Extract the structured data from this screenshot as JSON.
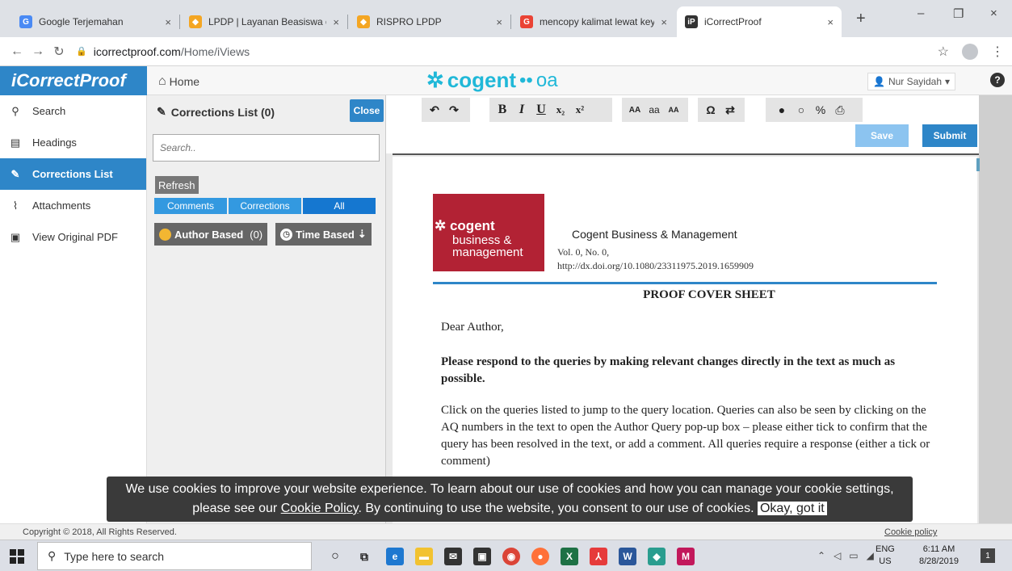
{
  "browser": {
    "tabs": [
      {
        "title": "Google Terjemahan",
        "icon": "google-translate-icon",
        "color": "#4a8af4"
      },
      {
        "title": "LPDP | Layanan Beasiswa da",
        "icon": "lpdp-icon",
        "color": "#f4a623"
      },
      {
        "title": "RISPRO LPDP",
        "icon": "lpdp-icon",
        "color": "#f4a623"
      },
      {
        "title": "mencopy kalimat lewat key",
        "icon": "google-icon",
        "color": "#ea4335"
      },
      {
        "title": "iCorrectProof",
        "icon": "icorrectproof-icon",
        "color": "#333333"
      }
    ],
    "tab_close": "×",
    "new_tab": "+",
    "window": {
      "minimize": "–",
      "restore": "❐",
      "close": "×"
    },
    "url_host": "icorrectproof.com",
    "url_path": "/Home/iViews"
  },
  "app": {
    "logo": "iCorrectProof",
    "home": "Home",
    "brand": "cogent",
    "brand_suffix": "oa",
    "user": "Nur Sayidah",
    "help": "?"
  },
  "nav": {
    "items": [
      {
        "label": "Search",
        "icon": "search-icon",
        "glyph": "⚲",
        "active": false
      },
      {
        "label": "Headings",
        "icon": "document-icon",
        "glyph": "🗎",
        "active": false
      },
      {
        "label": "Corrections List",
        "icon": "edit-icon",
        "glyph": "✎",
        "active": true
      },
      {
        "label": "Attachments",
        "icon": "paperclip-icon",
        "glyph": "✎",
        "active": false
      },
      {
        "label": "View Original PDF",
        "icon": "pdf-icon",
        "glyph": "🗎",
        "active": false
      }
    ]
  },
  "panel": {
    "title": "Corrections List (0)",
    "close": "Close",
    "search_placeholder": "Search..",
    "refresh": "Refresh",
    "filters": [
      "Comments",
      "Corrections",
      "All"
    ],
    "author_based": "Author Based",
    "author_count": "(0)",
    "time_based": "Time Based"
  },
  "toolbar": {
    "undo": "↶",
    "redo": "↷",
    "bold": "B",
    "italic": "I",
    "underline": "U",
    "subscript": "x₂",
    "superscript": "x²",
    "upper": "AA",
    "lower": "aa",
    "smallcaps": "AA",
    "special": "Ω",
    "swap": "⇄",
    "comment": "●",
    "bubble": "○",
    "link": "%",
    "print": "⎙",
    "save": "Save",
    "submit": "Submit"
  },
  "document": {
    "journal_logo_line1": "cogent",
    "journal_logo_line2": "business &",
    "journal_logo_line3": "management",
    "journal_title": "Cogent Business & Management",
    "volume": "Vol. 0, No. 0,",
    "doi": "http://dx.doi.org/10.1080/23311975.2019.1659909",
    "heading": "PROOF COVER SHEET",
    "greeting": "Dear Author,",
    "bold_paragraph": "Please respond to the queries by making relevant changes directly in the text as much as possible.",
    "paragraph": "Click on the queries listed to jump to the query location. Queries can also be seen by clicking on the AQ numbers in the text to open the Author Query pop-up box – please either tick to confirm that the query has been resolved in the text, or add a comment. All queries require a response (either a tick or comment)"
  },
  "cookie": {
    "text1": "We use cookies to improve your website experience. To learn about our use of cookies and how you can manage your cookie settings, please see our ",
    "link": "Cookie Policy",
    "text2": ". By continuing to use the website, you consent to our use of cookies. ",
    "ok": "Okay, got it"
  },
  "footer": {
    "copyright": "Copyright © 2018, All Rights Reserved.",
    "cookie_policy": "Cookie policy"
  },
  "taskbar": {
    "search_placeholder": "Type here to search",
    "lang": "ENG",
    "region": "US",
    "time": "6:11 AM",
    "date": "8/28/2019",
    "notifications": "1"
  }
}
